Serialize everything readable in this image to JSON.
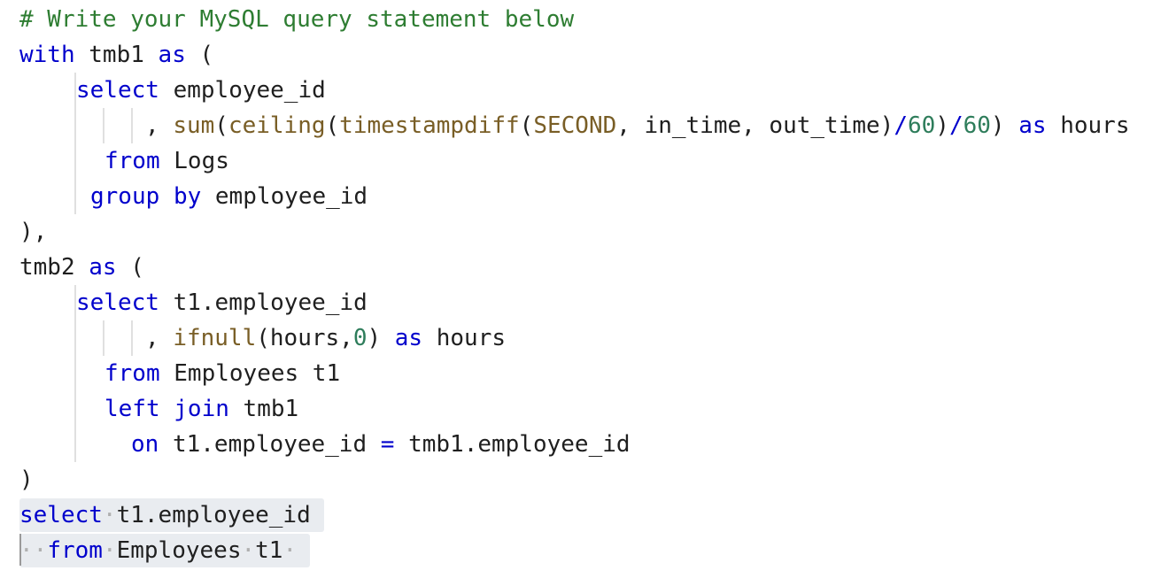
{
  "editor": {
    "lines": [
      [
        {
          "text": "# Write your MySQL query statement below",
          "class": "t-comment"
        }
      ],
      [
        {
          "text": "with",
          "class": "t-kw"
        },
        {
          "text": " tmb1 ",
          "class": "t-plain"
        },
        {
          "text": "as",
          "class": "t-kw"
        },
        {
          "text": " (",
          "class": "t-plain"
        }
      ],
      [
        {
          "text": "select",
          "class": "t-kw"
        },
        {
          "text": " employee_id",
          "class": "t-plain"
        }
      ],
      [
        {
          "text": ", ",
          "class": "t-plain"
        },
        {
          "text": "sum",
          "class": "t-fn"
        },
        {
          "text": "(",
          "class": "t-plain"
        },
        {
          "text": "ceiling",
          "class": "t-fn"
        },
        {
          "text": "(",
          "class": "t-plain"
        },
        {
          "text": "timestampdiff",
          "class": "t-fn"
        },
        {
          "text": "(",
          "class": "t-plain"
        },
        {
          "text": "SECOND",
          "class": "t-fn"
        },
        {
          "text": ", in_time, out_time)",
          "class": "t-plain"
        },
        {
          "text": "/",
          "class": "t-op"
        },
        {
          "text": "60",
          "class": "t-num"
        },
        {
          "text": ")",
          "class": "t-plain"
        },
        {
          "text": "/",
          "class": "t-op"
        },
        {
          "text": "60",
          "class": "t-num"
        },
        {
          "text": ") ",
          "class": "t-plain"
        },
        {
          "text": "as",
          "class": "t-kw"
        },
        {
          "text": " hours",
          "class": "t-plain"
        }
      ],
      [
        {
          "text": "from",
          "class": "t-kw"
        },
        {
          "text": " Logs",
          "class": "t-plain"
        }
      ],
      [
        {
          "text": "group",
          "class": "t-kw"
        },
        {
          "text": " ",
          "class": "t-plain"
        },
        {
          "text": "by",
          "class": "t-kw"
        },
        {
          "text": " employee_id",
          "class": "t-plain"
        }
      ],
      [
        {
          "text": "),",
          "class": "t-plain"
        }
      ],
      [
        {
          "text": "tmb2 ",
          "class": "t-plain"
        },
        {
          "text": "as",
          "class": "t-kw"
        },
        {
          "text": " (",
          "class": "t-plain"
        }
      ],
      [
        {
          "text": "select",
          "class": "t-kw"
        },
        {
          "text": " t1.employee_id",
          "class": "t-plain"
        }
      ],
      [
        {
          "text": ", ",
          "class": "t-plain"
        },
        {
          "text": "ifnull",
          "class": "t-fn"
        },
        {
          "text": "(hours,",
          "class": "t-plain"
        },
        {
          "text": "0",
          "class": "t-num"
        },
        {
          "text": ") ",
          "class": "t-plain"
        },
        {
          "text": "as",
          "class": "t-kw"
        },
        {
          "text": " hours",
          "class": "t-plain"
        }
      ],
      [
        {
          "text": "from",
          "class": "t-kw"
        },
        {
          "text": " Employees t1",
          "class": "t-plain"
        }
      ],
      [
        {
          "text": "left",
          "class": "t-kw"
        },
        {
          "text": " ",
          "class": "t-plain"
        },
        {
          "text": "join",
          "class": "t-kw"
        },
        {
          "text": " tmb1",
          "class": "t-plain"
        }
      ],
      [
        {
          "text": "on",
          "class": "t-kw"
        },
        {
          "text": " t1.employee_id ",
          "class": "t-plain"
        },
        {
          "text": "=",
          "class": "t-op"
        },
        {
          "text": " tmb1.employee_id",
          "class": "t-plain"
        }
      ],
      [
        {
          "text": ")",
          "class": "t-plain"
        }
      ],
      [
        {
          "text": "select",
          "class": "t-kw"
        },
        {
          "text": "·",
          "class": "t-dot"
        },
        {
          "text": "t1.employee_id",
          "class": "t-plain"
        }
      ],
      [
        {
          "text": "··",
          "class": "t-dot"
        },
        {
          "text": "from",
          "class": "t-kw"
        },
        {
          "text": "·",
          "class": "t-dot"
        },
        {
          "text": "Employees",
          "class": "t-plain"
        },
        {
          "text": "·",
          "class": "t-dot"
        },
        {
          "text": "t1",
          "class": "t-plain"
        },
        {
          "text": "·",
          "class": "t-dot"
        }
      ]
    ]
  }
}
